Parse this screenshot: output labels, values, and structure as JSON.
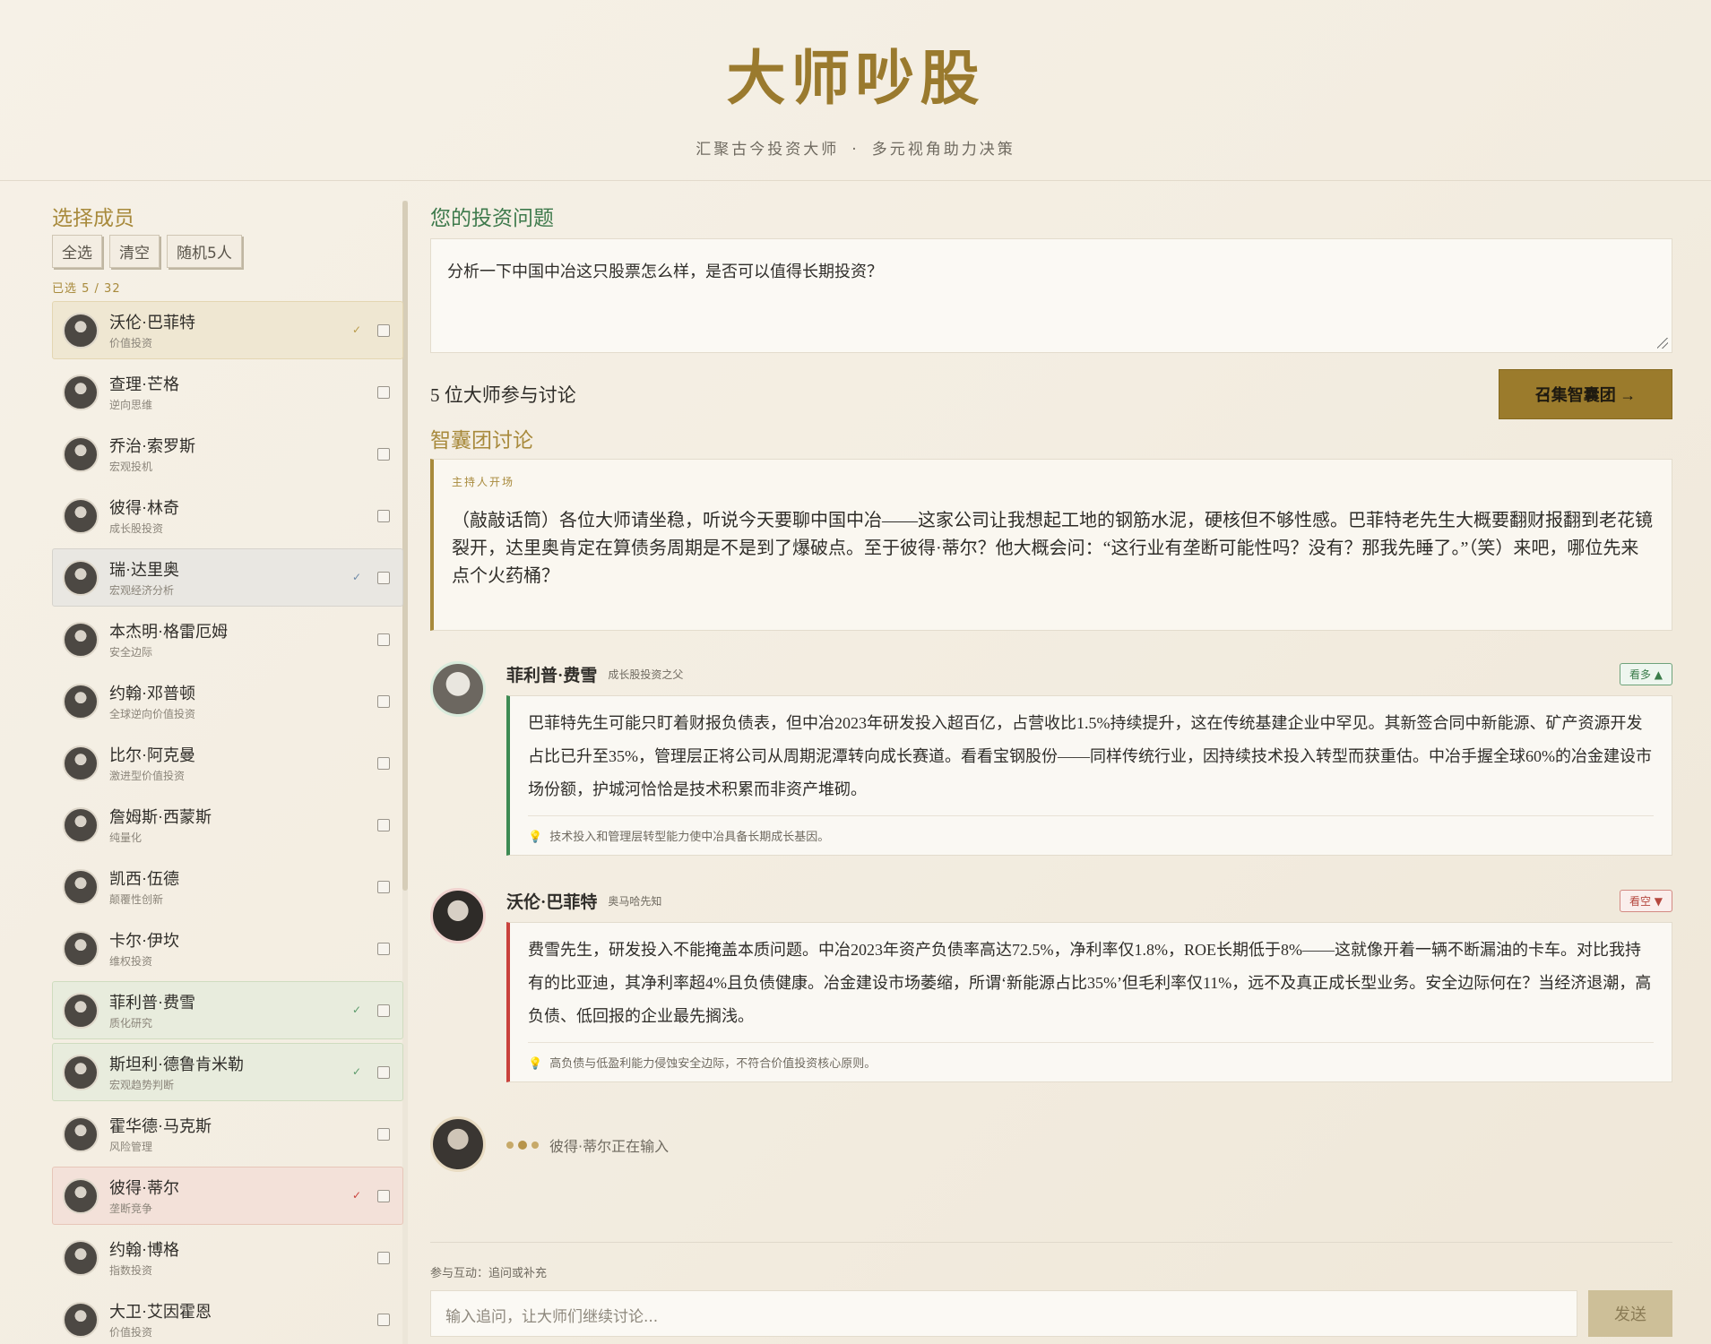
{
  "header": {
    "title": "大师吵股",
    "subtitle_left": "汇聚古今投资大师",
    "subtitle_dot": "·",
    "subtitle_right": "多元视角助力决策"
  },
  "sidebar": {
    "title": "选择成员",
    "buttons": {
      "select_all": "全选",
      "clear": "清空",
      "random": "随机5人"
    },
    "count": "已选 5 / 32",
    "members": [
      {
        "name": "沃伦·巴菲特",
        "tag": "价值投资",
        "selected": true
      },
      {
        "name": "查理·芒格",
        "tag": "逆向思维",
        "selected": false
      },
      {
        "name": "乔治·索罗斯",
        "tag": "宏观投机",
        "selected": false
      },
      {
        "name": "彼得·林奇",
        "tag": "成长股投资",
        "selected": false
      },
      {
        "name": "瑞·达里奥",
        "tag": "宏观经济分析",
        "selected": true
      },
      {
        "name": "本杰明·格雷厄姆",
        "tag": "安全边际",
        "selected": false
      },
      {
        "name": "约翰·邓普顿",
        "tag": "全球逆向价值投资",
        "selected": false
      },
      {
        "name": "比尔·阿克曼",
        "tag": "激进型价值投资",
        "selected": false
      },
      {
        "name": "詹姆斯·西蒙斯",
        "tag": "纯量化",
        "selected": false
      },
      {
        "name": "凯西·伍德",
        "tag": "颠覆性创新",
        "selected": false
      },
      {
        "name": "卡尔·伊坎",
        "tag": "维权投资",
        "selected": false
      },
      {
        "name": "菲利普·费雪",
        "tag": "质化研究",
        "selected": true
      },
      {
        "name": "斯坦利·德鲁肯米勒",
        "tag": "宏观趋势判断",
        "selected": true
      },
      {
        "name": "霍华德·马克斯",
        "tag": "风险管理",
        "selected": false
      },
      {
        "name": "彼得·蒂尔",
        "tag": "垄断竞争",
        "selected": true
      },
      {
        "name": "约翰·博格",
        "tag": "指数投资",
        "selected": false
      },
      {
        "name": "大卫·艾因霍恩",
        "tag": "价值投资",
        "selected": false
      }
    ],
    "check_mark": "✓"
  },
  "main": {
    "question_label": "您的投资问题",
    "question_text": "分析一下中国中冶这只股票怎么样，是否可以值得长期投资？",
    "participants": "5 位大师参与讨论",
    "summon_button": "召集智囊团 →",
    "discussion_label": "智囊团讨论",
    "host": {
      "label": "主持人开场",
      "text": "（敲敲话筒）各位大师请坐稳，听说今天要聊中国中冶——这家公司让我想起工地的钢筋水泥，硬核但不够性感。巴菲特老先生大概要翻财报翻到老花镜裂开，达里奥肯定在算债务周期是不是到了爆破点。至于彼得·蒂尔？他大概会问：“这行业有垄断可能性吗？没有？那我先睡了。”（笑）来吧，哪位先来点个火药桶？"
    },
    "messages": [
      {
        "name": "菲利普·费雪",
        "title": "成长股投资之父",
        "stance": "看多 ▲",
        "text": "巴菲特先生可能只盯着财报负债表，但中冶2023年研发投入超百亿，占营收比1.5%持续提升，这在传统基建企业中罕见。其新签合同中新能源、矿产资源开发占比已升至35%，管理层正将公司从周期泥潭转向成长赛道。看看宝钢股份——同样传统行业，因持续技术投入转型而获重估。中冶手握全球60%的冶金建设市场份额，护城河恰恰是技术积累而非资产堆砌。",
        "summary": "技术投入和管理层转型能力使中冶具备长期成长基因。"
      },
      {
        "name": "沃伦·巴菲特",
        "title": "奥马哈先知",
        "stance": "看空 ▼",
        "text": "费雪先生，研发投入不能掩盖本质问题。中冶2023年资产负债率高达72.5%，净利率仅1.8%，ROE长期低于8%——这就像开着一辆不断漏油的卡车。对比我持有的比亚迪，其净利率超4%且负债健康。冶金建设市场萎缩，所谓‘新能源占比35%’但毛利率仅11%，远不及真正成长型业务。安全边际何在？当经济退潮，高负债、低回报的企业最先搁浅。",
        "summary": "高负债与低盈利能力侵蚀安全边际，不符合价值投资核心原则。"
      }
    ],
    "typing": "彼得·蒂尔正在输入",
    "bulb_icon": "💡",
    "interact_label": "参与互动：追问或补充",
    "followup_placeholder": "输入追问，让大师们继续讨论...",
    "send_button": "发送"
  }
}
